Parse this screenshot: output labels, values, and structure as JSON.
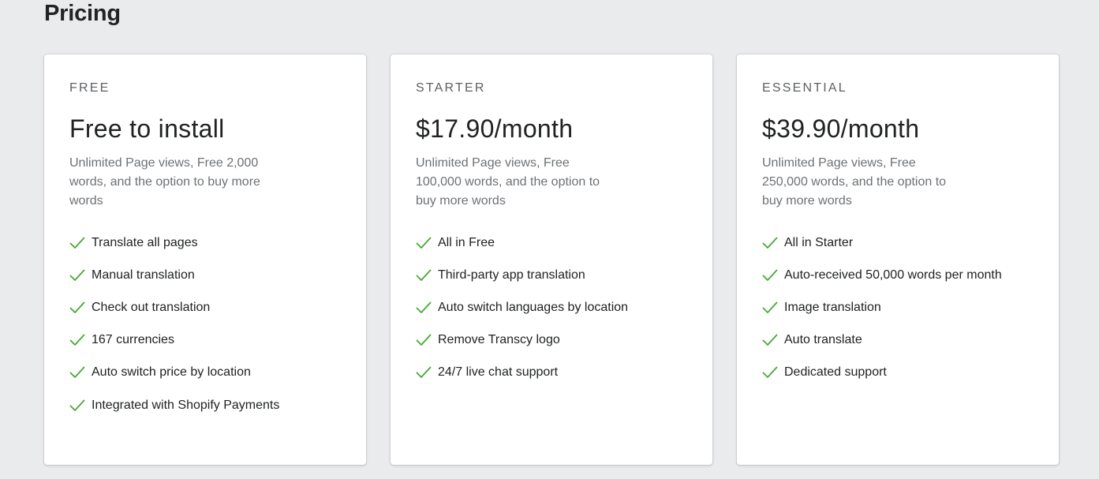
{
  "page": {
    "title": "Pricing"
  },
  "colors": {
    "check": "#46a935",
    "background": "#eaebed",
    "card": "#ffffff"
  },
  "plans": [
    {
      "name": "FREE",
      "price": "Free to install",
      "description": "Unlimited Page views, Free 2,000 words, and the option to buy more words",
      "features": [
        "Translate all pages",
        "Manual translation",
        "Check out translation",
        "167 currencies",
        "Auto switch price by location",
        "Integrated with Shopify Payments"
      ]
    },
    {
      "name": "STARTER",
      "price": "$17.90/month",
      "description": "Unlimited Page views, Free 100,000 words, and the option to buy more words",
      "features": [
        "All in Free",
        "Third-party app translation",
        "Auto switch languages by location",
        "Remove Transcy logo",
        "24/7 live chat support"
      ]
    },
    {
      "name": "ESSENTIAL",
      "price": "$39.90/month",
      "description": "Unlimited Page views, Free 250,000 words, and the option to buy more words",
      "features": [
        "All in Starter",
        "Auto-received 50,000 words per month",
        "Image translation",
        "Auto translate",
        "Dedicated support"
      ]
    }
  ]
}
